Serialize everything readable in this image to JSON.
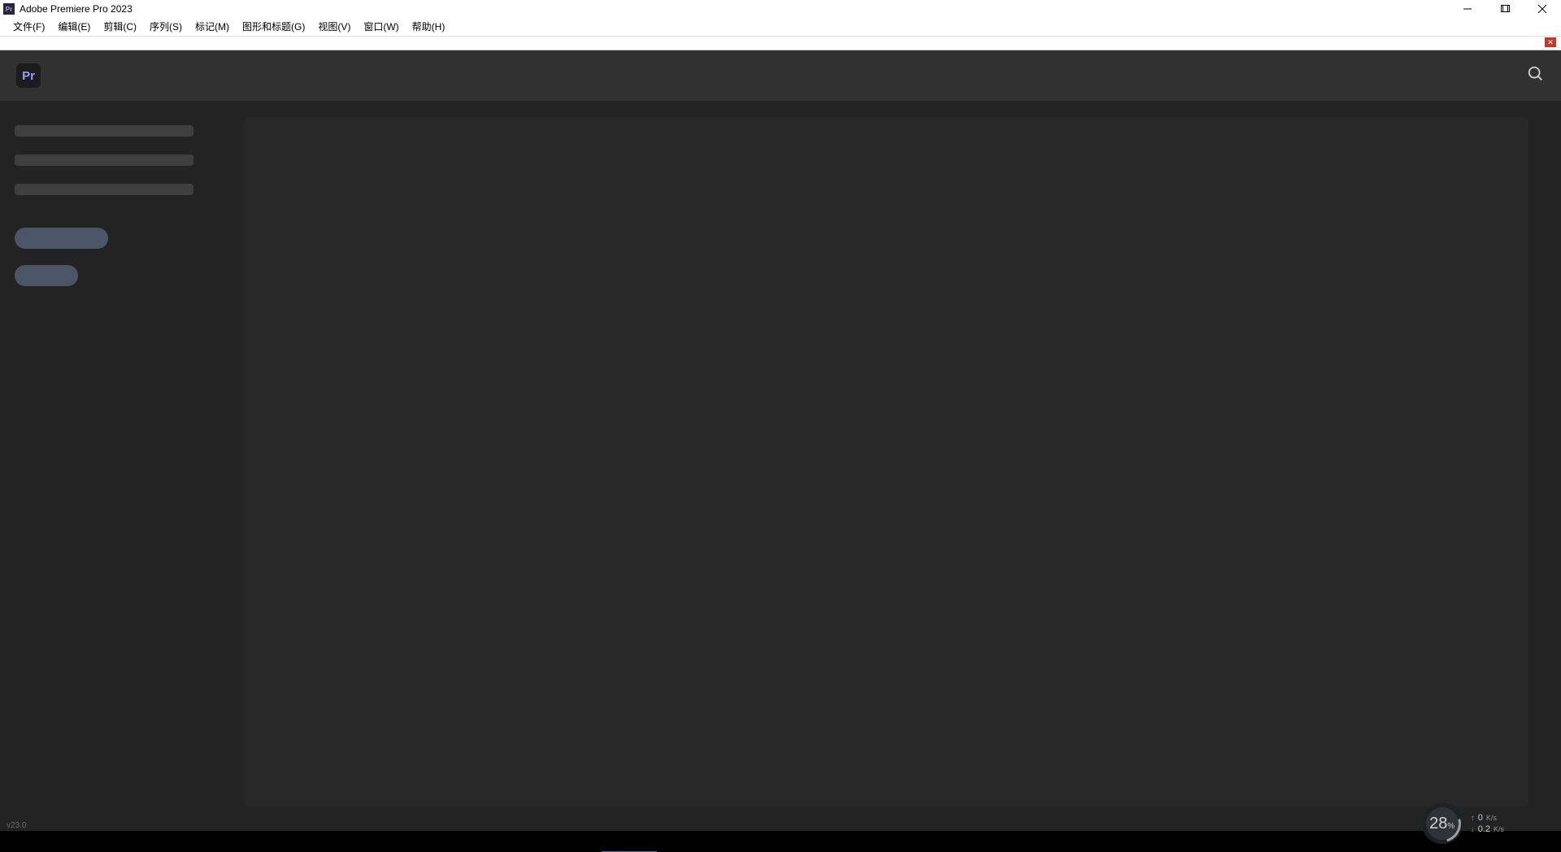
{
  "title": "Adobe Premiere Pro 2023",
  "appIconText": "Pr",
  "menus": [
    "文件(F)",
    "编辑(E)",
    "剪辑(C)",
    "序列(S)",
    "标记(M)",
    "图形和标题(G)",
    "视图(V)",
    "窗口(W)",
    "帮助(H)"
  ],
  "logoText": "Pr",
  "footer": "v23.0",
  "network": {
    "cpuValue": "28",
    "cpuPercent": "%",
    "upValue": "0",
    "upUnit": "K/s",
    "dnValue": "0.2",
    "dnUnit": "K/s"
  }
}
